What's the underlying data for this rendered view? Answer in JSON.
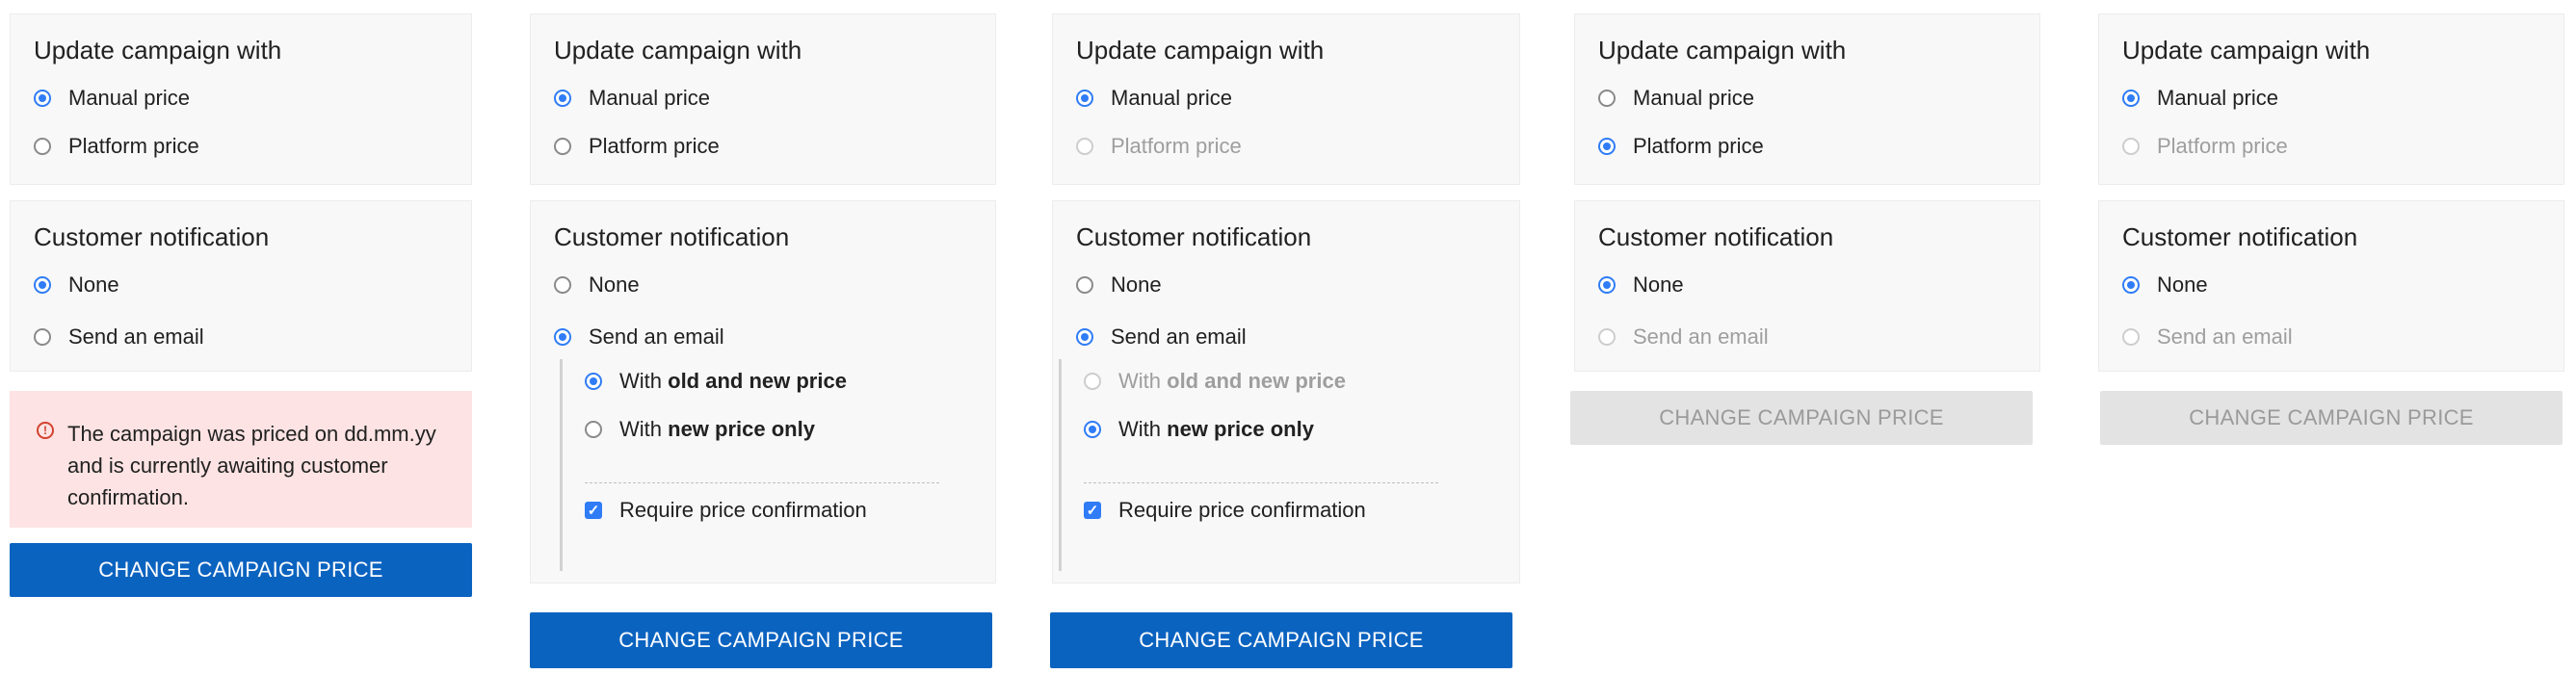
{
  "common": {
    "update_title": "Update campaign with",
    "notif_title": "Customer notification",
    "manual_price": "Manual price",
    "platform_price": "Platform price",
    "none": "None",
    "send_email": "Send an email",
    "with_prefix": "With",
    "old_and_new": "old and new price",
    "new_only": "new price only",
    "require_confirmation": "Require price confirmation",
    "change_button": "CHANGE CAMPAIGN PRICE"
  },
  "panels": [
    {
      "update_selected": "Manual price",
      "notification_selected": "None",
      "alert_text": "The campaign was priced on dd.mm.yy and is currently awaiting customer confirmation.",
      "button_enabled": true
    },
    {
      "update_selected": "Manual price",
      "notification_selected": "Send an email",
      "email_option_selected": "old and new price",
      "require_confirmation_checked": true,
      "button_enabled": true
    },
    {
      "update_selected": "Manual price",
      "platform_disabled": true,
      "notification_selected": "Send an email",
      "email_option_selected": "new price only",
      "old_and_new_disabled": true,
      "require_confirmation_checked": true,
      "button_enabled": true
    },
    {
      "update_selected": "Platform price",
      "notification_selected": "None",
      "send_email_disabled": true,
      "button_enabled": false
    },
    {
      "update_selected": "Manual price",
      "platform_disabled": true,
      "notification_selected": "None",
      "send_email_disabled": true,
      "button_enabled": false
    }
  ],
  "colors": {
    "accent": "#2f7cf6",
    "button": "#0b63c0",
    "button_disabled": "#e3e3e3",
    "alert_bg": "#fde3e3",
    "alert_icon": "#d3412f"
  }
}
